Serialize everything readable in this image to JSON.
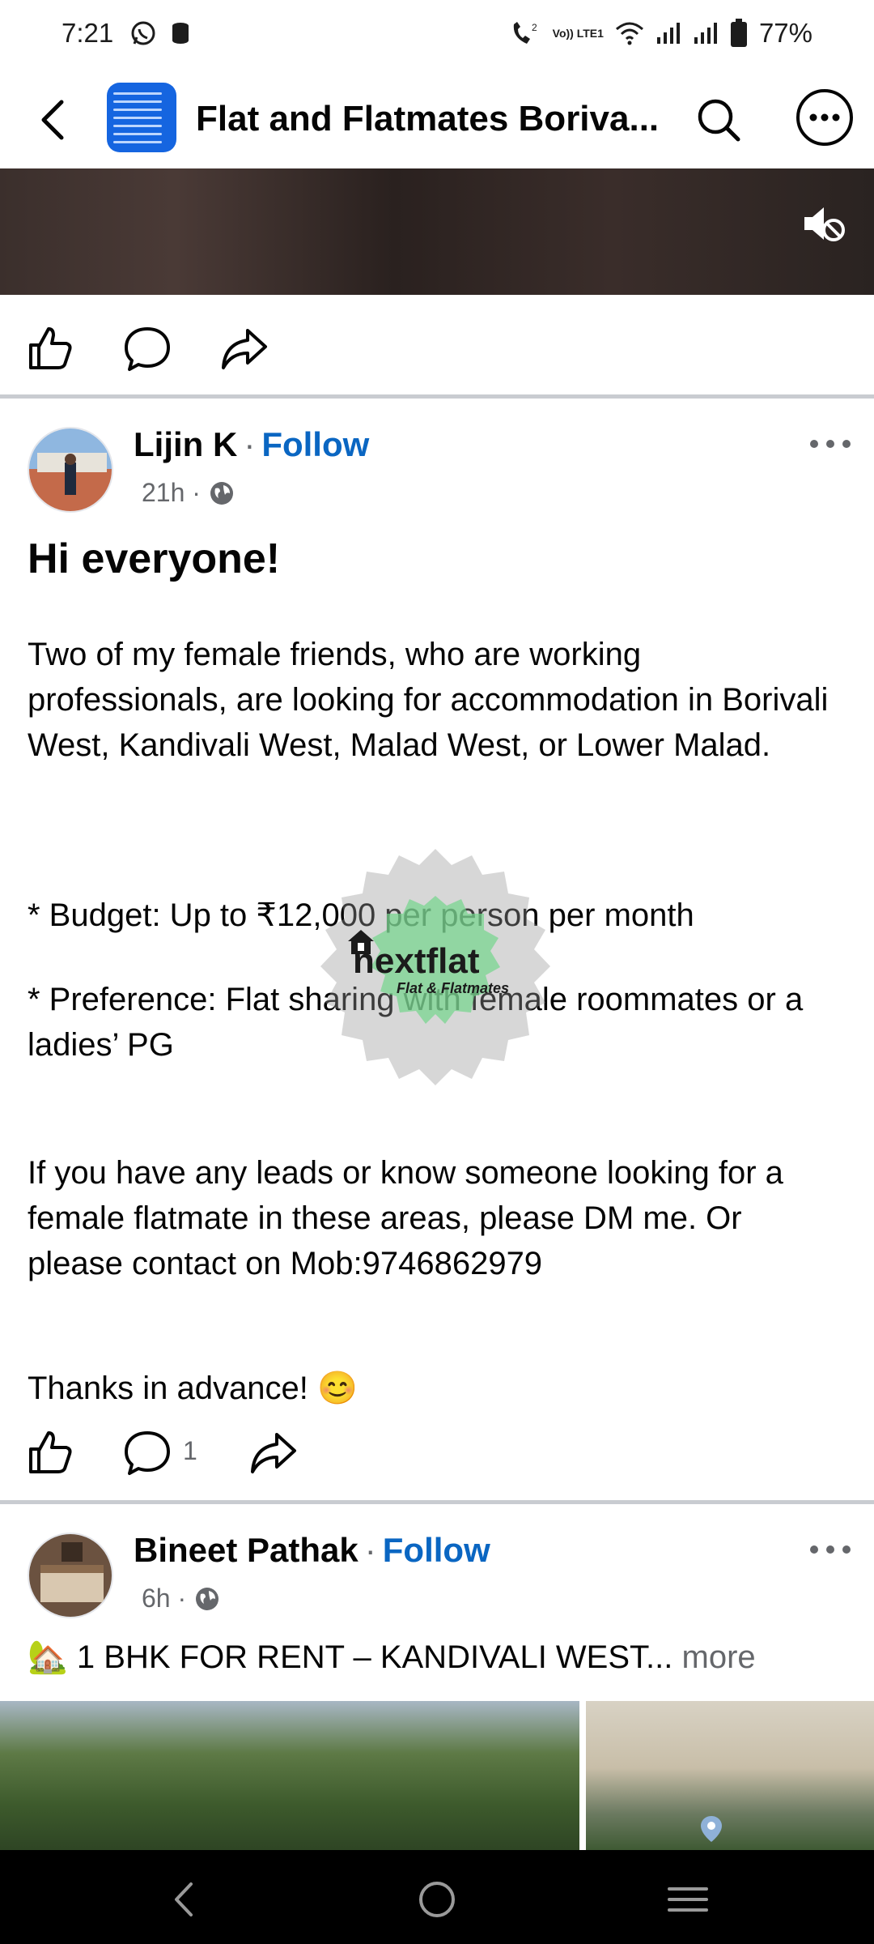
{
  "status_bar": {
    "time": "7:21",
    "battery": "77%",
    "lte_label": "Vo)) LTE1",
    "icons": [
      "whatsapp-icon",
      "storage-icon",
      "wifi-call-icon",
      "volte-icon",
      "wifi-icon",
      "signal-icon",
      "signal-icon",
      "battery-icon"
    ]
  },
  "header": {
    "title": "Flat and Flatmates Boriva...",
    "icons": [
      "back-arrow-icon",
      "search-icon",
      "more-icon"
    ]
  },
  "top_post": {
    "actions": [
      "like-icon",
      "comment-icon",
      "share-icon"
    ]
  },
  "post1": {
    "author": "Lijin K",
    "separator": "·",
    "follow": "Follow",
    "time": "21h ·",
    "heading": "Hi everyone!",
    "p1": "Two of my female friends, who are working professionals, are looking for accommodation in Borivali West, Kandivali West, Malad West, or Lower Malad.",
    "p2": "* Budget: Up to ₹12,000 per person per month",
    "p3": "* Preference: Flat sharing with female roommates or a ladies’ PG",
    "p4": "If you have any leads or know someone looking for a female flatmate in these areas, please DM me. Or please contact on Mob:9746862979",
    "p5": "Thanks in advance! 😊",
    "comment_count": "1",
    "watermark_brand": "nextflat",
    "watermark_sub": "Flat & Flatmates"
  },
  "post2": {
    "author": "Bineet Pathak",
    "separator": "·",
    "follow": "Follow",
    "time": "6h ·",
    "preview": "🏡 1 BHK FOR RENT – KANDIVALI WEST...",
    "more": " more"
  },
  "colors": {
    "follow_blue": "#0a66c2",
    "group_avatar_blue": "#1565e0",
    "secondary_text": "#65676b",
    "divider": "#c9ccd1"
  }
}
